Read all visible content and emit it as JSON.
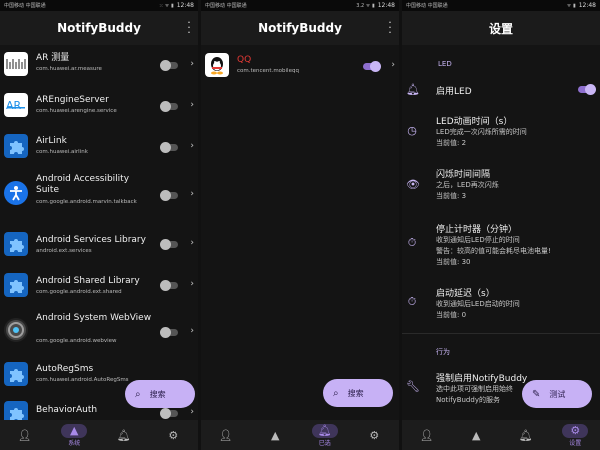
{
  "status": {
    "s1": {
      "left": "中国移动 中国联通",
      "icons": "⁙ ᯤ ▮",
      "time": "12:48"
    },
    "s2": {
      "left": "中国移动 中国联通",
      "icons": "3.2 ᯤ ▮",
      "time": "12:48"
    },
    "s3": {
      "left": "中国移动 中国联通",
      "icons": "ᯤ ▮",
      "time": "12:48"
    }
  },
  "screen1": {
    "title": "NotifyBuddy",
    "apps": [
      {
        "name": "AR 测量",
        "pkg": "com.huawei.ar.measure",
        "icon": "ar-measure-icon",
        "toggle": false
      },
      {
        "name": "AREngineServer",
        "pkg": "com.huawei.arengine.service",
        "icon": "ar-engine-icon",
        "toggle": false
      },
      {
        "name": "AirLink",
        "pkg": "com.huawei.airlink",
        "icon": "puzzle-icon",
        "toggle": false
      },
      {
        "name": "Android Accessibility Suite",
        "pkg": "com.google.android.marvin.talkback",
        "icon": "accessibility-icon",
        "toggle": false
      },
      {
        "name": "Android Services Library",
        "pkg": "android.ext.services",
        "icon": "puzzle-icon",
        "toggle": false
      },
      {
        "name": "Android Shared Library",
        "pkg": "com.google.android.ext.shared",
        "icon": "puzzle-icon",
        "toggle": false
      },
      {
        "name": "Android System WebView",
        "pkg": "com.google.android.webview",
        "icon": "webview-icon",
        "toggle": false
      },
      {
        "name": "AutoRegSms",
        "pkg": "com.huawei.android.AutoRegSms",
        "icon": "puzzle-icon",
        "toggle": false
      },
      {
        "name": "BehaviorAuth",
        "pkg": "",
        "icon": "puzzle-icon",
        "toggle": false
      }
    ],
    "fab": "搜索",
    "nav": [
      "",
      "系统",
      "",
      ""
    ]
  },
  "screen2": {
    "title": "NotifyBuddy",
    "apps": [
      {
        "name": "QQ",
        "pkg": "com.tencent.mobileqq",
        "icon": "qq-icon",
        "toggle": true
      }
    ],
    "fab": "搜索",
    "nav": [
      "",
      "",
      "已选",
      ""
    ]
  },
  "screen3": {
    "title": "设置",
    "section_led": "LED",
    "enable_led": "启用LED",
    "enable_led_on": true,
    "items": [
      {
        "title": "LED动画时间（s）",
        "lines": [
          "LED完成一次闪烁所需的时间",
          "当前值: 2"
        ],
        "icon": "timer-icon"
      },
      {
        "title": "闪烁时间间隔",
        "lines": [
          "之后，LED再次闪烁",
          "当前值: 3"
        ],
        "icon": "eye-icon"
      },
      {
        "title": "停止计时器（分钟）",
        "lines": [
          "收到通知后LED停止的时间",
          "警告：较高的值可能会耗尽电池电量!",
          "当前值: 30"
        ],
        "icon": "stopwatch-icon"
      },
      {
        "title": "启动延迟（s）",
        "lines": [
          "收到通知后LED启动的时间",
          "当前值: 0"
        ],
        "icon": "stopwatch-icon"
      }
    ],
    "section_behavior": "行为",
    "force": {
      "title": "强制启用NotifyBuddy",
      "lines": [
        "选中此项可强制启用始终",
        "NotifyBuddy的服务"
      ]
    },
    "fab": "测试",
    "nav": [
      "",
      "",
      "",
      "设置"
    ]
  },
  "colors": {
    "accent": "#c7b1f5",
    "background": "#141414"
  }
}
